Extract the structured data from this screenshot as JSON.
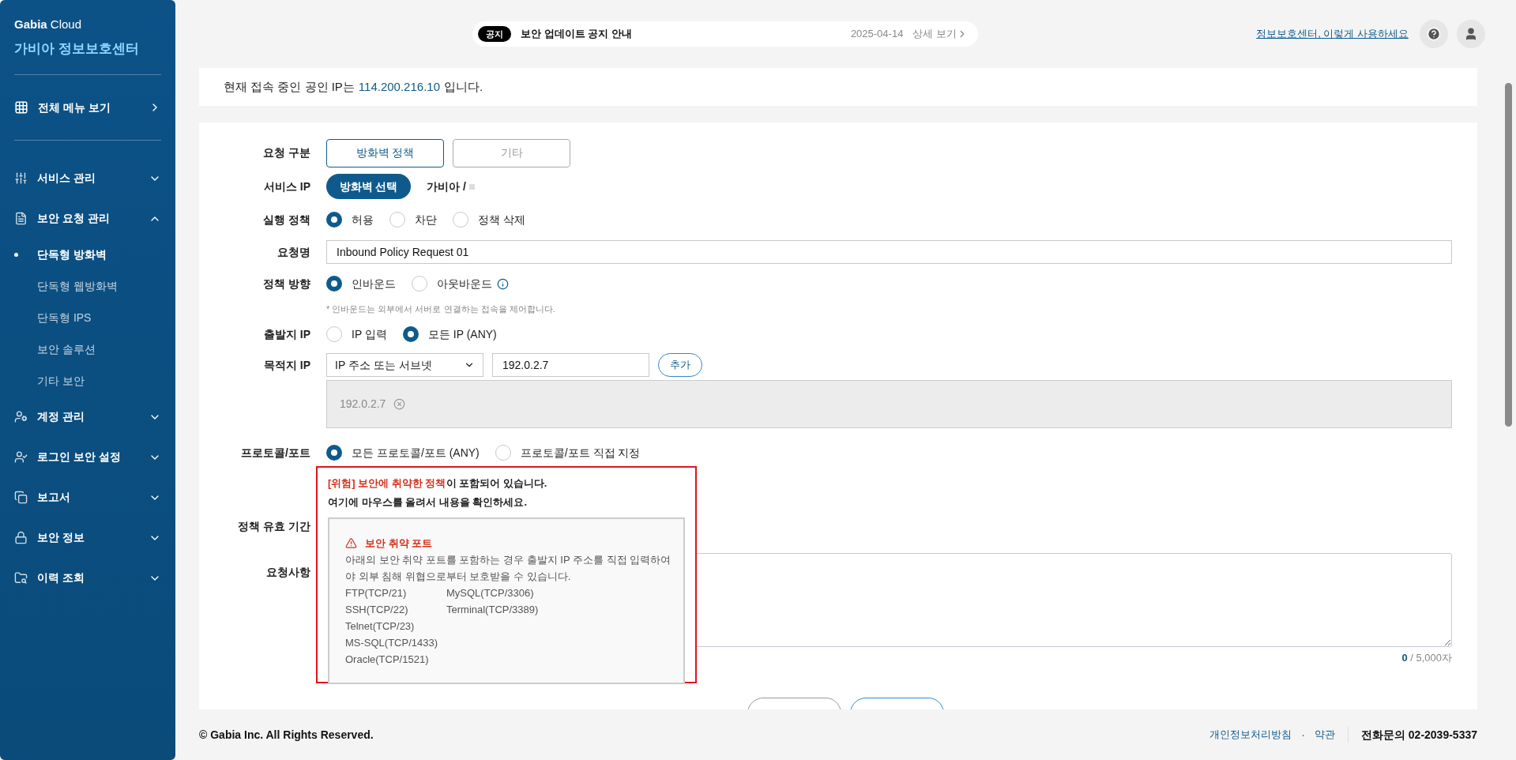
{
  "sidebar": {
    "brand": "**Gabia** Cloud",
    "title": "가비아 정보보호센터",
    "all_menu": "전체 메뉴 보기",
    "items": [
      {
        "label": "서비스 관리",
        "expanded": false
      },
      {
        "label": "보안 요청 관리",
        "expanded": true,
        "children": [
          {
            "label": "단독형 방화벽",
            "selected": true
          },
          {
            "label": "단독형 웹방화벽",
            "selected": false
          },
          {
            "label": "단독형 IPS",
            "selected": false
          },
          {
            "label": "보안 솔루션",
            "selected": false
          },
          {
            "label": "기타 보안",
            "selected": false
          }
        ]
      },
      {
        "label": "계정 관리",
        "expanded": false
      },
      {
        "label": "로그인 보안 설정",
        "expanded": false
      },
      {
        "label": "보고서",
        "expanded": false
      },
      {
        "label": "보안 정보",
        "expanded": false
      },
      {
        "label": "이력 조회",
        "expanded": false
      }
    ]
  },
  "notice": {
    "badge": "공지",
    "title": "보안 업데이트 공지 안내",
    "date": "2025-04-14",
    "link": "상세 보기"
  },
  "header_link": "정보보호센터, 이렇게 사용하세요",
  "ip_notice": {
    "prefix": "현재 접속 중인 공인 IP는",
    "ip": "114.200.216.10",
    "suffix": "입니다."
  },
  "form": {
    "request_type": {
      "label": "요청 구분",
      "options": [
        {
          "label": "방화벽 정책",
          "selected": true
        },
        {
          "label": "기타",
          "selected": false
        }
      ]
    },
    "service_ip": {
      "label": "서비스 IP",
      "button": "방화벽 선택",
      "value": "가비아 /"
    },
    "action": {
      "label": "실행 정책",
      "options": [
        {
          "label": "허용",
          "selected": true
        },
        {
          "label": "차단",
          "selected": false
        },
        {
          "label": "정책 삭제",
          "selected": false
        }
      ]
    },
    "name": {
      "label": "요청명",
      "value": "Inbound Policy Request 01"
    },
    "direction": {
      "label": "정책 방향",
      "options": [
        {
          "label": "인바운드",
          "selected": true
        },
        {
          "label": "아웃바운드",
          "selected": false
        }
      ],
      "note": "* 인바운드는 외부에서 서버로 연결하는 접속을 제어합니다."
    },
    "source_ip": {
      "label": "출발지 IP",
      "options": [
        {
          "label": "IP 입력",
          "selected": false
        },
        {
          "label": "모든 IP (ANY)",
          "selected": true
        }
      ]
    },
    "dest_ip": {
      "label": "목적지 IP",
      "select": "IP 주소 또는 서브넷",
      "value": "192.0.2.7",
      "add": "추가",
      "chips": [
        {
          "label": "192.0.2.7"
        }
      ]
    },
    "protocol": {
      "label": "프로토콜/포트",
      "options": [
        {
          "label": "모든 프로토콜/포트 (ANY)",
          "selected": true
        },
        {
          "label": "프로토콜/포트 직접 지정",
          "selected": false
        }
      ]
    },
    "validity": {
      "label": "정책 유효 기간"
    },
    "request": {
      "label": "요청사항",
      "count": "0",
      "max": "/ 5,000자"
    }
  },
  "warning": {
    "alert": "[위험] 보안에 취약한 정책",
    "headline_rest": "이 포함되어 있습니다.",
    "instruction": "여기에 마우스를 올려서 내용을 확인하세요.",
    "panel": {
      "title": "보안 취약 포트",
      "description": "아래의 보안 취약 포트를 포함하는 경우 출발지 IP 주소를 직접 입력하여야 외부 침해 위협으로부터 보호받을 수 있습니다.",
      "port_columns": [
        [
          "FTP(TCP/21)",
          "SSH(TCP/22)",
          "Telnet(TCP/23)",
          "MS-SQL(TCP/1433)",
          "Oracle(TCP/1521)"
        ],
        [
          "MySQL(TCP/3306)",
          "Terminal(TCP/3389)"
        ]
      ]
    }
  },
  "footer": {
    "copyright": "© Gabia Inc. All Rights Reserved.",
    "links": [
      "개인정보처리방침",
      "약관"
    ],
    "separator": "·",
    "phone": "전화문의 02-2039-5337"
  }
}
